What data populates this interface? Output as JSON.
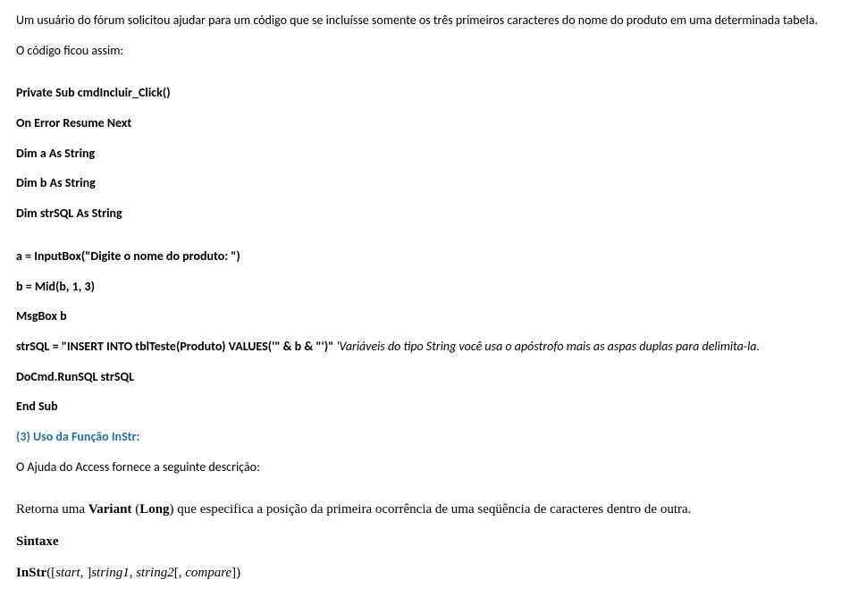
{
  "intro": "Um usuário do fórum solicitou ajudar para um código que se incluísse somente os três primeiros caracteres do nome do produto em uma determinada tabela.",
  "lead": "O código ficou assim:",
  "code": {
    "l1": "Private Sub cmdIncluir_Click()",
    "l2": "On Error Resume Next",
    "l3": "Dim a As String",
    "l4": "Dim b As String",
    "l5": "Dim strSQL As String",
    "l6": "a = InputBox(\"Digite o nome do produto: \")",
    "l7": "b = Mid(b, 1, 3)",
    "l8": "MsgBox b",
    "l9": "strSQL = \"INSERT INTO tblTeste(Produto) VALUES('\" & b & \"')\"   ",
    "comment": "'Variáveis do tipo String você usa o apóstrofo mais as aspas duplas para delimita-la.",
    "l10": "DoCmd.RunSQL strSQL",
    "l11": "End Sub"
  },
  "section_heading": "(3) Uso da Função InStr:",
  "help_intro": "O Ajuda do Access fornece a seguinte descrição:",
  "return_desc": {
    "part1": "Retorna uma ",
    "part2": "Variant",
    "part3": " (",
    "part4": "Long",
    "part5": ") que especifica a posição da primeira ocorrência de uma seqüência de caracteres dentro de outra."
  },
  "syntax_label": "Sintaxe",
  "syntax_line": {
    "p1": "InStr",
    "p2": "([",
    "p3": "start",
    "p4": ", ]",
    "p5": "string1",
    "p6": ", ",
    "p7": "string2",
    "p8": "[, ",
    "p9": "compare",
    "p10": "])"
  }
}
